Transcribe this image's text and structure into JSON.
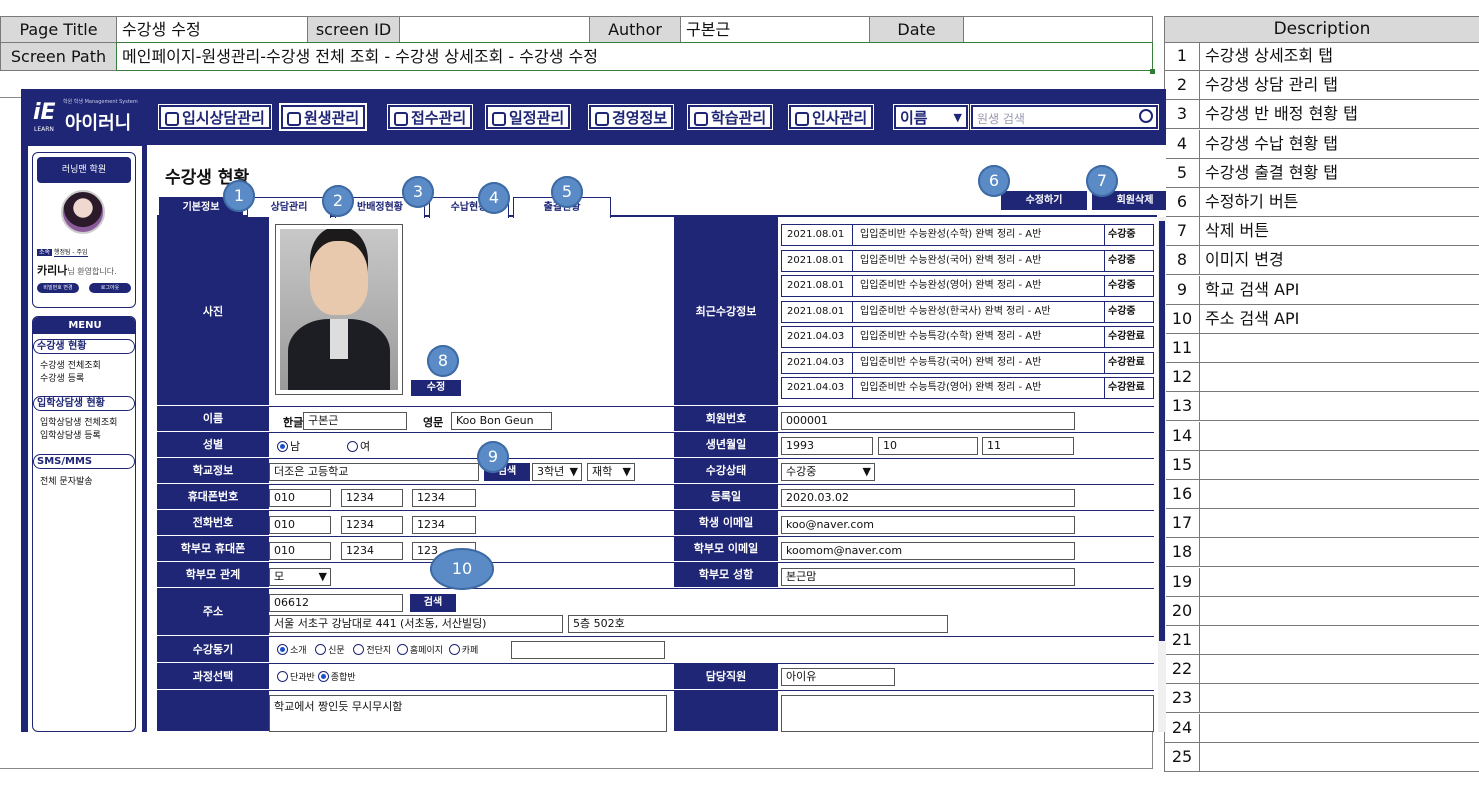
{
  "spec": {
    "page_title_label": "Page Title",
    "page_title_value": "수강생 수정",
    "screen_id_label": "screen ID",
    "screen_id_value": "",
    "author_label": "Author",
    "author_value": "구본근",
    "date_label": "Date",
    "date_value": "",
    "screen_path_label": "Screen Path",
    "screen_path_value": "메인페이지-원생관리-수강생 전체 조회 - 수강생 상세조회 - 수강생 수정"
  },
  "description": {
    "header": "Description",
    "rows": [
      {
        "num": "1",
        "text": "수강생 상세조회 탭"
      },
      {
        "num": "2",
        "text": "수강생 상담 관리 탭"
      },
      {
        "num": "3",
        "text": "수강생 반 배정 현황 탭"
      },
      {
        "num": "4",
        "text": "수강생 수납 현황 탭"
      },
      {
        "num": "5",
        "text": "수강생 출결 현황 탭"
      },
      {
        "num": "6",
        "text": "수정하기 버튼"
      },
      {
        "num": "7",
        "text": "삭제 버튼"
      },
      {
        "num": "8",
        "text": "이미지 변경"
      },
      {
        "num": "9",
        "text": "학교 검색 API"
      },
      {
        "num": "10",
        "text": "주소 검색 API"
      },
      {
        "num": "11",
        "text": ""
      },
      {
        "num": "12",
        "text": ""
      },
      {
        "num": "13",
        "text": ""
      },
      {
        "num": "14",
        "text": ""
      },
      {
        "num": "15",
        "text": ""
      },
      {
        "num": "16",
        "text": ""
      },
      {
        "num": "17",
        "text": ""
      },
      {
        "num": "18",
        "text": ""
      },
      {
        "num": "19",
        "text": ""
      },
      {
        "num": "20",
        "text": ""
      },
      {
        "num": "21",
        "text": ""
      },
      {
        "num": "22",
        "text": ""
      },
      {
        "num": "23",
        "text": ""
      },
      {
        "num": "24",
        "text": ""
      },
      {
        "num": "25",
        "text": ""
      }
    ]
  },
  "app": {
    "logo_tagline": "학원 학생 Management System",
    "logo_text": "아이러니",
    "logo_mark": "iE",
    "logo_sub": "LEARN",
    "nav": [
      "입시상담관리",
      "원생관리",
      "접수관리",
      "일정관리",
      "경영정보",
      "학습관리",
      "인사관리"
    ],
    "search_select": "이름",
    "search_placeholder": "원생 검색",
    "colors": {
      "navy": "#1f2675",
      "badge": "#5b8bc7"
    },
    "sidebar": {
      "academy": "러닝맨 학원",
      "role_tag": "소속",
      "role_value": "행정팀 - 주임",
      "user_name": "카리나",
      "greeting": "님 환영합니다.",
      "btn_pw": "비밀번호 변경",
      "btn_logout": "로그아웃",
      "menu_title": "MENU",
      "groups": [
        {
          "title": "수강생 현황",
          "items": [
            "수강생 전체조회",
            "수강생 등록"
          ]
        },
        {
          "title": "입학상담생 현황",
          "items": [
            "입학상담생 전체조회",
            "입학상담생 등록"
          ]
        },
        {
          "title": "SMS/MMS",
          "items": [
            "전체 문자발송"
          ]
        }
      ]
    },
    "page_heading": "수강생 현황",
    "tabs": [
      "기본정보",
      "상담관리",
      "반배정현황",
      "수납현황",
      "출결현황"
    ],
    "btn_edit": "수정하기",
    "btn_delete": "회원삭제",
    "photo_label": "사진",
    "photo_btn": "수정",
    "recent_label": "최근수강정보",
    "recent": [
      {
        "date": "2021.08.01",
        "course": "입입준비반 수능완성(수학) 완벽 정리 - A반",
        "status": "수강중"
      },
      {
        "date": "2021.08.01",
        "course": "입입준비반 수능완성(국어) 완벽 정리 - A반",
        "status": "수강중"
      },
      {
        "date": "2021.08.01",
        "course": "입입준비반 수능완성(영어) 완벽 정리 - A반",
        "status": "수강중"
      },
      {
        "date": "2021.08.01",
        "course": "입입준비반 수능완성(한국사) 완벽 정리 - A반",
        "status": "수강중"
      },
      {
        "date": "2021.04.03",
        "course": "입입준비반 수능특강(수학) 완벽 정리 - A반",
        "status": "수강완료"
      },
      {
        "date": "2021.04.03",
        "course": "입입준비반 수능특강(국어) 완벽 정리 - A반",
        "status": "수강완료"
      },
      {
        "date": "2021.04.03",
        "course": "입입준비반 수능특강(영어) 완벽 정리 - A반",
        "status": "수강완료"
      }
    ],
    "form": {
      "name_label": "이름",
      "kor_label": "한글",
      "kor_value": "구본근",
      "eng_label": "영문",
      "eng_value": "Koo Bon Geun",
      "member_no_label": "회원번호",
      "member_no": "000001",
      "gender_label": "성별",
      "gender_m": "남",
      "gender_f": "여",
      "birth_label": "생년월일",
      "birth_y": "1993",
      "birth_m": "10",
      "birth_d": "11",
      "school_label": "학교정보",
      "school_value": "더조은 고등학교",
      "school_btn": "검색",
      "grade": "3학년",
      "enroll": "재학",
      "status_label": "수강상태",
      "status_value": "수강중",
      "phone_label": "휴대폰번호",
      "phone": [
        "010",
        "1234",
        "1234"
      ],
      "reg_label": "등록일",
      "reg_value": "2020.03.02",
      "tel_label": "전화번호",
      "tel": [
        "010",
        "1234",
        "1234"
      ],
      "email_label": "학생 이메일",
      "email_value": "koo@naver.com",
      "pphone_label": "학부모 휴대폰",
      "pphone": [
        "010",
        "1234",
        "123"
      ],
      "pemail_label": "학부모 이메일",
      "pemail_value": "koomom@naver.com",
      "relation_label": "학부모 관계",
      "relation_value": "모",
      "pname_label": "학부모 성함",
      "pname_value": "본근맘",
      "addr_label": "주소",
      "zip": "06612",
      "addr_btn": "검색",
      "addr1": "서울 서초구 강남대로 441 (서초동, 서산빌딩)",
      "addr2": "5층 502호",
      "motive_label": "수강동기",
      "motives": [
        "소개",
        "신문",
        "전단지",
        "홈페이지",
        "카페"
      ],
      "course_label": "과정선택",
      "course_a": "단과반",
      "course_b": "종합반",
      "staff_label": "담당직원",
      "staff_value": "아이유",
      "memo_value": "학교에서 짱인듯 무시무시함"
    },
    "badges": [
      "1",
      "2",
      "3",
      "4",
      "5",
      "6",
      "7",
      "8",
      "9",
      "10"
    ]
  }
}
